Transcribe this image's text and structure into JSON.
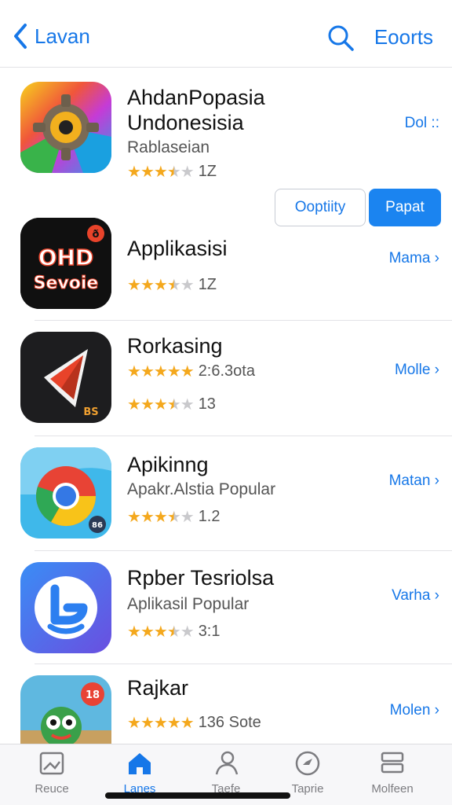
{
  "nav": {
    "back_label": "Lavan",
    "right_label": "Eoorts"
  },
  "apps": [
    {
      "title_line1": "AhdanPopasia",
      "title_line2": "Undonesisia",
      "subtitle": "Rablaseian",
      "rating": 3.5,
      "count": "1Z",
      "action": "Dol ::",
      "buttons": {
        "outline": "Ooptiity",
        "primary": "Papat"
      }
    },
    {
      "title": "Applikasisi",
      "rating": 3.5,
      "count": "1Z",
      "action": "Mama ›",
      "icon_text_1": "OHD",
      "icon_text_2": "Sevoie"
    },
    {
      "title": "Rorkasing",
      "rating_line1": 5,
      "count_line1": "2:6.3ota",
      "rating": 3.5,
      "count": "13",
      "action": "Molle ›",
      "icon_badge": "BS"
    },
    {
      "title": "Apikinng",
      "subtitle": "Apakr.Alstia Popular",
      "rating": 3.5,
      "count": "1.2",
      "action": "Matan ›",
      "icon_badge": "86"
    },
    {
      "title": "Rpber Tesriolsa",
      "subtitle": "Aplikasil Popular",
      "rating": 3.5,
      "count": "3:1",
      "action": "Varha ›"
    },
    {
      "title": "Rajkar",
      "rating": 5,
      "count": "136 Sote",
      "action": "Molen ›",
      "icon_badge": "18"
    }
  ],
  "tabs": [
    {
      "label": "Reuce",
      "icon": "square-icon"
    },
    {
      "label": "Lanes",
      "icon": "house-icon",
      "active": true
    },
    {
      "label": "Taefe",
      "icon": "search-person-icon"
    },
    {
      "label": "Taprie",
      "icon": "compass-icon"
    },
    {
      "label": "Molfeen",
      "icon": "layers-icon"
    }
  ],
  "colors": {
    "accent": "#1677e8",
    "star": "#f4a81d",
    "button_fill": "#1b84f0"
  }
}
